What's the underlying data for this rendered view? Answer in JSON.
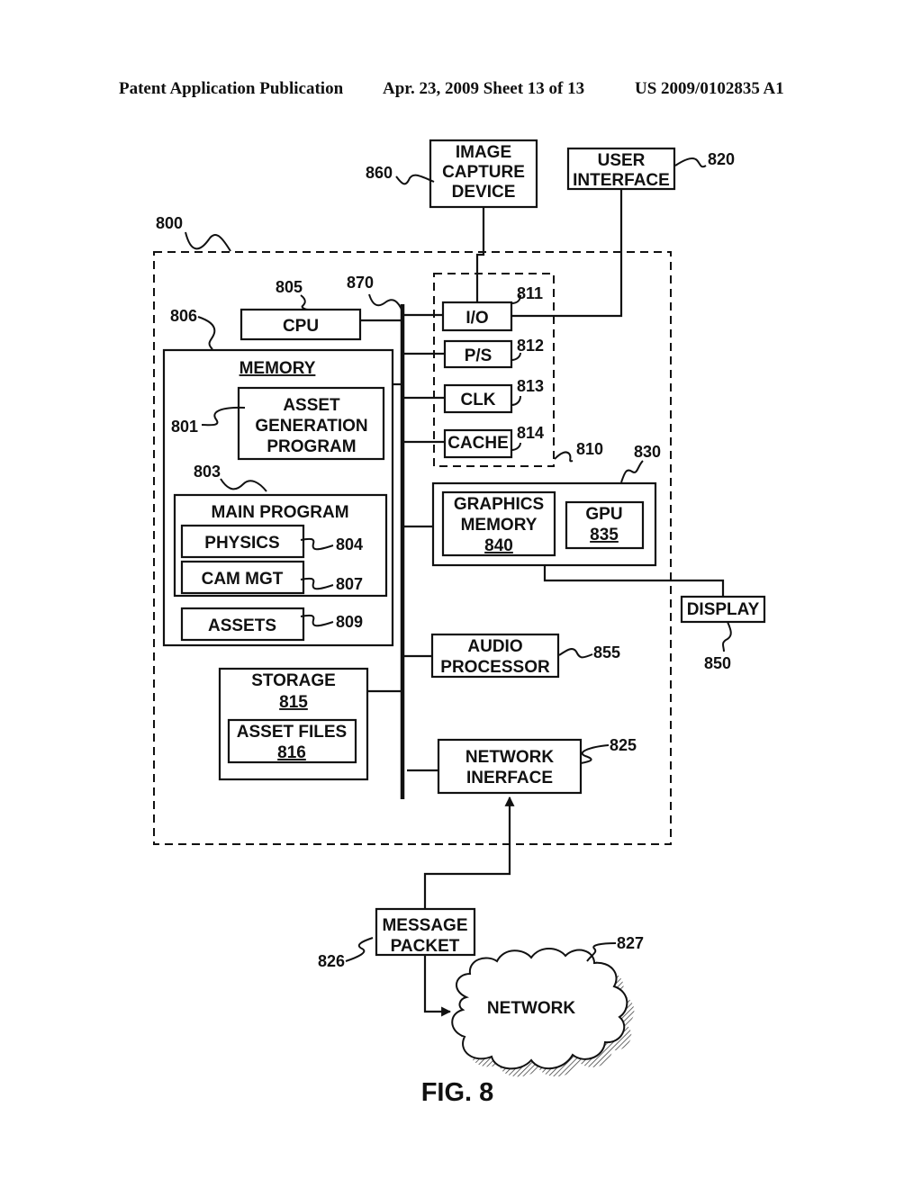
{
  "header": {
    "publication": "Patent Application Publication",
    "date_sheet": "Apr. 23, 2009  Sheet 13 of 13",
    "number": "US 2009/0102835 A1"
  },
  "figure": {
    "caption": "FIG. 8",
    "system_ref": "800",
    "bus_ref": "870",
    "blocks": {
      "image_capture": {
        "lines": [
          "IMAGE",
          "CAPTURE",
          "DEVICE"
        ],
        "ref": "860"
      },
      "user_interface": {
        "lines": [
          "USER",
          "INTERFACE"
        ],
        "ref": "820"
      },
      "cpu": {
        "label": "CPU",
        "ref": "805"
      },
      "memory": {
        "label": "MEMORY",
        "ref": "806"
      },
      "asset_gen": {
        "lines": [
          "ASSET",
          "GENERATION",
          "PROGRAM"
        ],
        "ref": "801"
      },
      "main_program": {
        "label": "MAIN PROGRAM",
        "ref": "803"
      },
      "physics": {
        "label": "PHYSICS",
        "ref": "804"
      },
      "cam_mgt": {
        "label": "CAM MGT",
        "ref": "807"
      },
      "assets": {
        "label": "ASSETS",
        "ref": "809"
      },
      "support_group": {
        "ref": "810"
      },
      "io": {
        "label": "I/O",
        "ref": "811"
      },
      "ps": {
        "label": "P/S",
        "ref": "812"
      },
      "clk": {
        "label": "CLK",
        "ref": "813"
      },
      "cache": {
        "label": "CACHE",
        "ref": "814"
      },
      "graphics_subsystem": {
        "ref": "830"
      },
      "graphics_memory": {
        "lines": [
          "GRAPHICS",
          "MEMORY"
        ],
        "ref": "840"
      },
      "gpu": {
        "label": "GPU",
        "ref": "835"
      },
      "display": {
        "label": "DISPLAY",
        "ref": "850"
      },
      "audio": {
        "lines": [
          "AUDIO",
          "PROCESSOR"
        ],
        "ref": "855"
      },
      "storage": {
        "label": "STORAGE",
        "ref": "815"
      },
      "asset_files": {
        "label": "ASSET FILES",
        "ref": "816"
      },
      "network_interface": {
        "lines": [
          "NETWORK",
          "INERFACE"
        ],
        "ref": "825"
      },
      "message_packet": {
        "lines": [
          "MESSAGE",
          "PACKET"
        ],
        "ref": "826"
      },
      "network": {
        "label": "NETWORK",
        "ref": "827"
      }
    }
  }
}
